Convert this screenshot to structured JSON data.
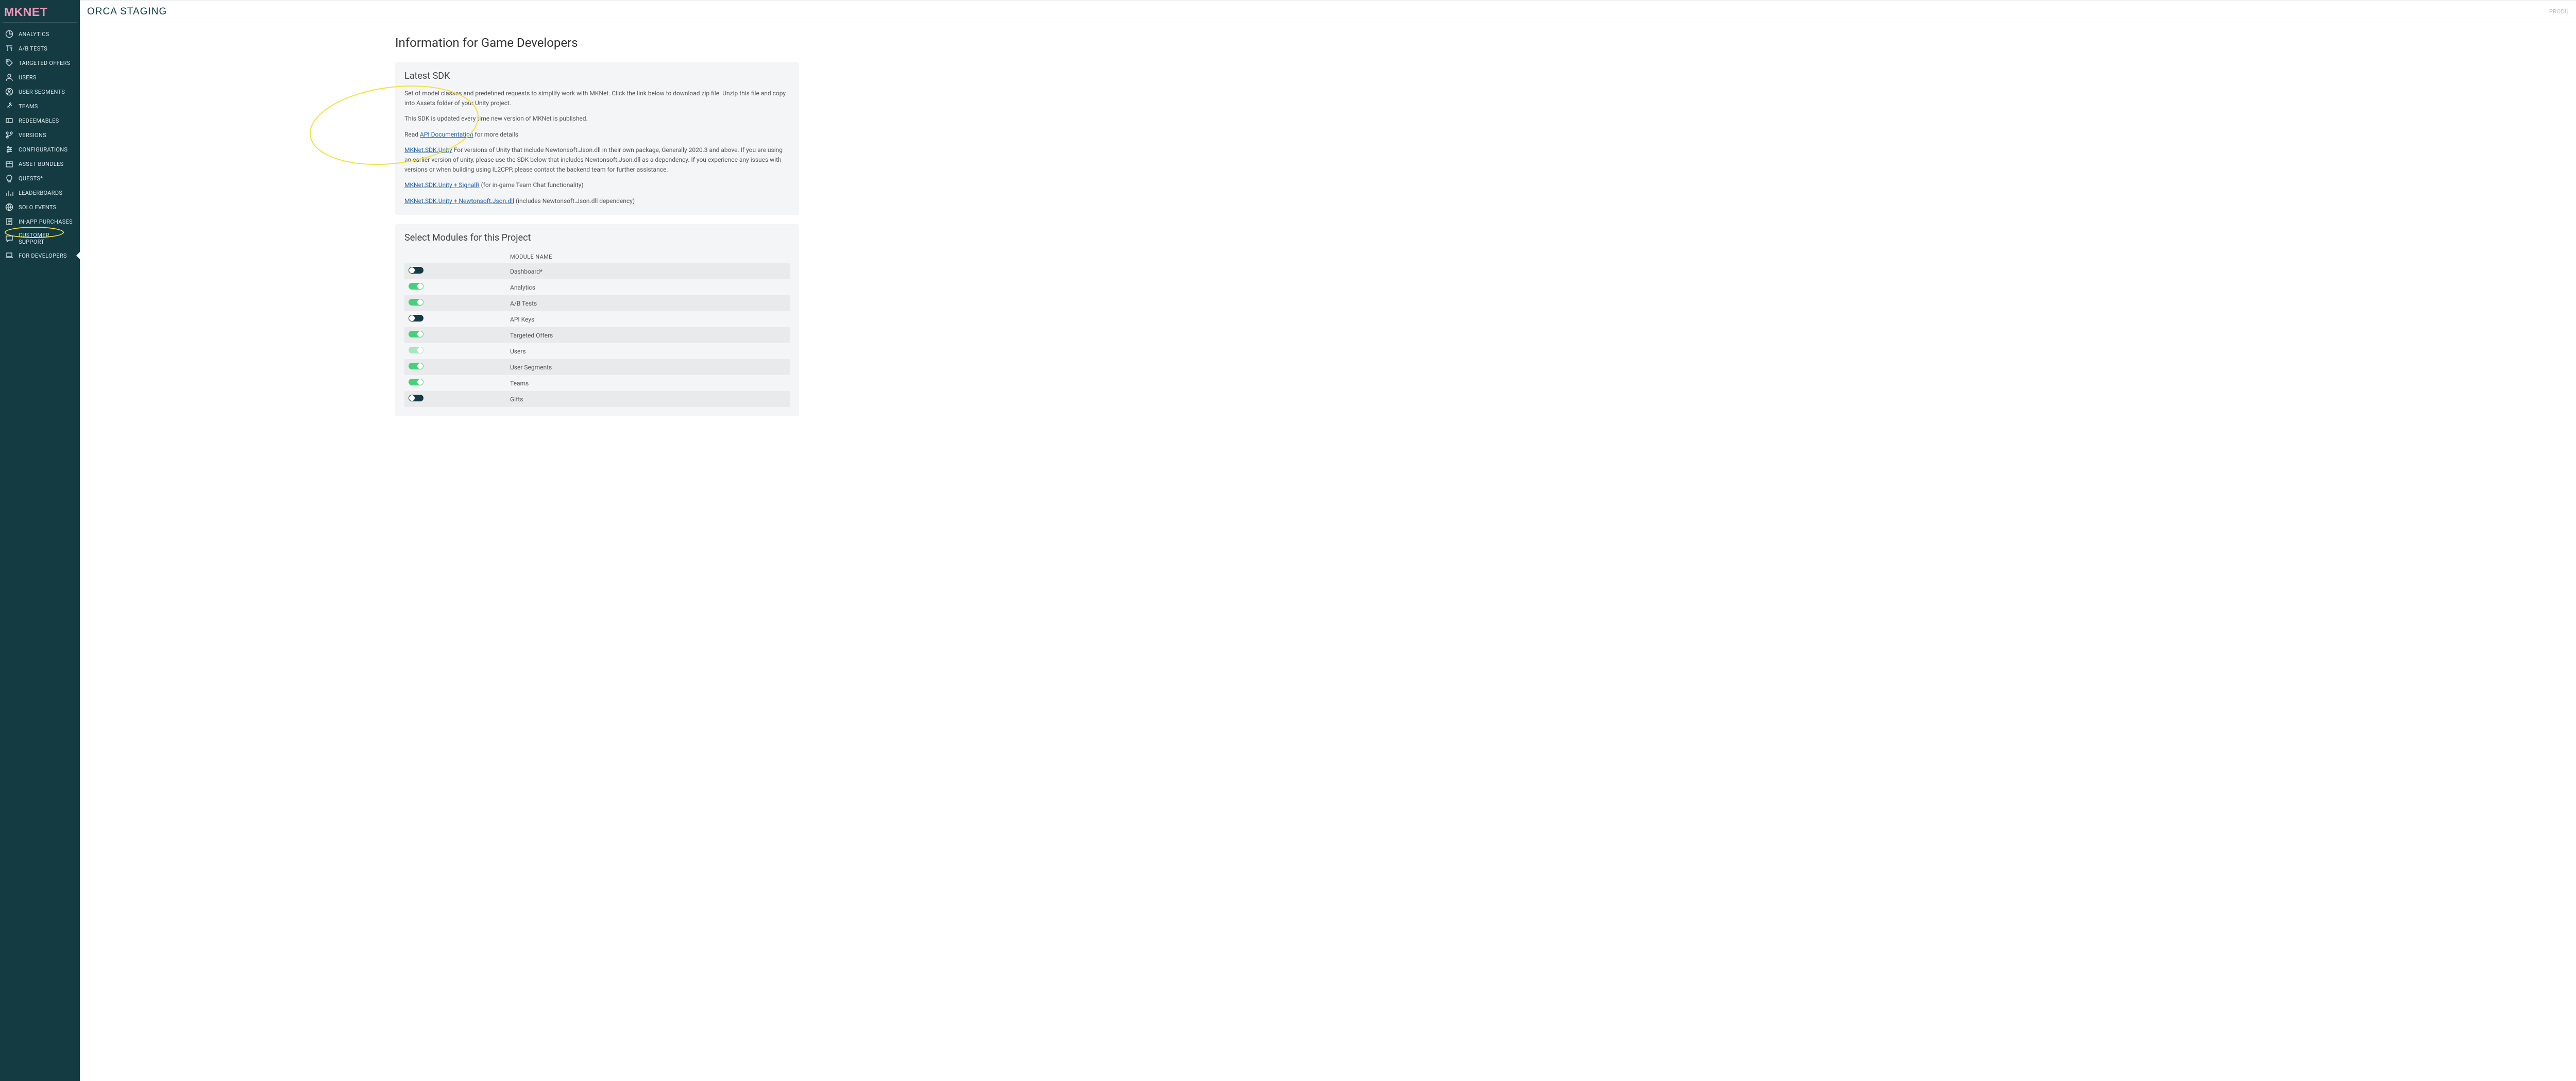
{
  "brand": "MKNET",
  "header": {
    "title": "ORCA STAGING",
    "right": "PRODU"
  },
  "nav": [
    {
      "id": "analytics",
      "label": "ANALYTICS",
      "icon": "pie-icon"
    },
    {
      "id": "abtests",
      "label": "A/B TESTS",
      "icon": "text-icon"
    },
    {
      "id": "targeted-offers",
      "label": "TARGETED OFFERS",
      "icon": "tag-icon"
    },
    {
      "id": "users",
      "label": "USERS",
      "icon": "user-icon"
    },
    {
      "id": "user-segments",
      "label": "USER SEGMENTS",
      "icon": "users-icon"
    },
    {
      "id": "teams",
      "label": "TEAMS",
      "icon": "run-icon"
    },
    {
      "id": "redeemables",
      "label": "REDEEMABLES",
      "icon": "ticket-icon"
    },
    {
      "id": "versions",
      "label": "VERSIONS",
      "icon": "branch-icon"
    },
    {
      "id": "configurations",
      "label": "CONFIGURATIONS",
      "icon": "sliders-icon"
    },
    {
      "id": "asset-bundles",
      "label": "ASSET BUNDLES",
      "icon": "package-icon"
    },
    {
      "id": "quests",
      "label": "QUESTS*",
      "icon": "bulb-icon"
    },
    {
      "id": "leaderboards",
      "label": "LEADERBOARDS",
      "icon": "bars-icon"
    },
    {
      "id": "solo-events",
      "label": "SOLO EVENTS",
      "icon": "globe-icon"
    },
    {
      "id": "iap",
      "label": "IN-APP PURCHASES",
      "icon": "receipt-icon"
    },
    {
      "id": "customer-support",
      "label": "CUSTOMER SUPPORT",
      "icon": "chat-icon"
    },
    {
      "id": "for-developers",
      "label": "FOR DEVELOPERS",
      "icon": "laptop-icon",
      "selected": true
    }
  ],
  "page": {
    "title": "Information for Game Developers",
    "sdk": {
      "heading": "Latest SDK",
      "p1": "Set of model classes and predefined requests to simplify work with MKNet. Click the link below to download zip file. Unzip this file and copy into Assets folder of your Unity project.",
      "p2": "This SDK is updated every time new version of MKNet is published.",
      "p3_pre": "Read ",
      "p3_link": "API Documentation",
      "p3_post": " for more details",
      "l1_link": "MKNet.SDK.Unity",
      "l1_post": " For versions of Unity that include Newtonsoft.Json.dll in their own package, Generally 2020.3 and above. If you are using an earlier version of unity, please use the SDK below that includes Newtonsoft.Json.dll as a dependency. If you experience any issues with versions or when building using IL2CPP, please contact the backend team for further assistance.",
      "l2_link": "MKNet.SDK.Unity + SignalR",
      "l2_post": " (for in-game Team Chat functionality)",
      "l3_link": "MKNet.SDK.Unity + Newtonsoft.Json.dll",
      "l3_post": " (includes Newtonsoft.Json.dll dependency)"
    },
    "modules": {
      "heading": "Select Modules for this Project",
      "column": "MODULE NAME",
      "rows": [
        {
          "name": "Dashboard*",
          "on": false
        },
        {
          "name": "Analytics",
          "on": true
        },
        {
          "name": "A/B Tests",
          "on": true
        },
        {
          "name": "API Keys",
          "on": false
        },
        {
          "name": "Targeted Offers",
          "on": true
        },
        {
          "name": "Users",
          "on": true,
          "locked": true
        },
        {
          "name": "User Segments",
          "on": true
        },
        {
          "name": "Teams",
          "on": true
        },
        {
          "name": "Gifts",
          "on": false
        }
      ]
    }
  }
}
